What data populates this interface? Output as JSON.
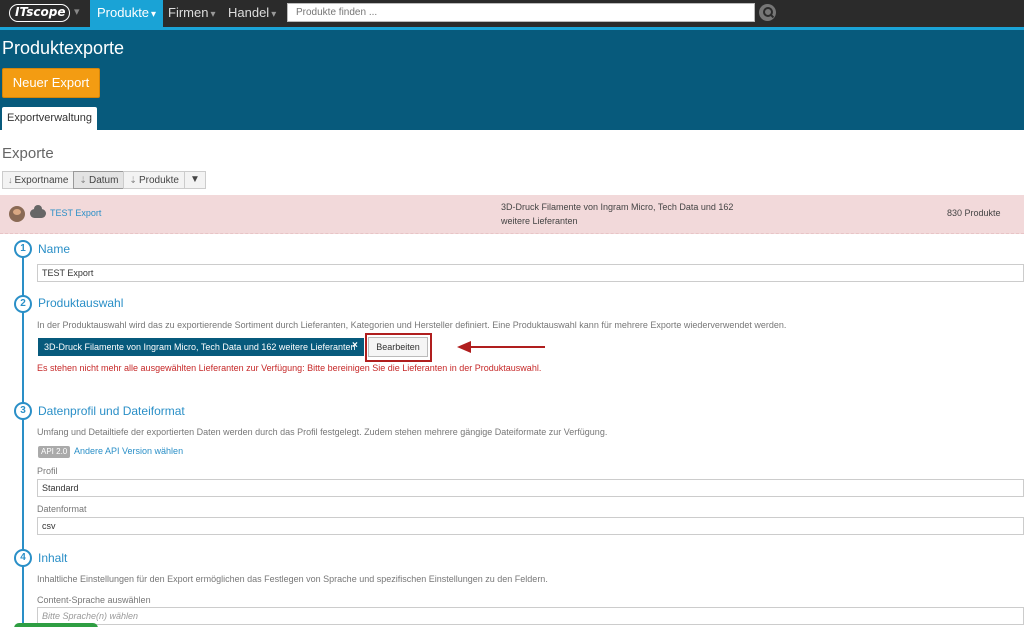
{
  "nav": {
    "logo": "ITscope",
    "items": [
      {
        "label": "Produkte",
        "active": true
      },
      {
        "label": "Firmen",
        "active": false
      },
      {
        "label": "Handel",
        "active": false
      }
    ],
    "search_placeholder": "Produkte finden ..."
  },
  "header": {
    "title": "Produktexporte",
    "new_button": "Neuer Export",
    "tab": "Exportverwaltung"
  },
  "exports": {
    "title": "Exporte",
    "sort_buttons": [
      {
        "label": "Exportname",
        "active": false
      },
      {
        "label": "Datum",
        "active": true
      },
      {
        "label": "Produkte",
        "active": false
      }
    ],
    "row": {
      "name": "TEST Export",
      "description_line1": "3D-Druck Filamente von Ingram Micro, Tech Data und 162",
      "description_line2": "weitere Lieferanten",
      "count": "830 Produkte"
    }
  },
  "steps": {
    "name": {
      "number": "1",
      "title": "Name",
      "value": "TEST Export"
    },
    "selection": {
      "number": "2",
      "title": "Produktauswahl",
      "help": "In der Produktauswahl wird das zu exportierende Sortiment durch Lieferanten, Kategorien und Hersteller definiert. Eine Produktauswahl kann für mehrere Exporte wiederverwendet werden.",
      "chip_label": "3D-Druck Filamente von Ingram Micro, Tech Data und 162 weitere Lieferanten",
      "chip_close": "×",
      "edit_button": "Bearbeiten",
      "error": "Es stehen nicht mehr alle ausgewählten Lieferanten zur Verfügung: Bitte bereinigen Sie die Lieferanten in der Produktauswahl."
    },
    "profile": {
      "number": "3",
      "title": "Datenprofil und Dateiformat",
      "help": "Umfang und Detailtiefe der exportierten Daten werden durch das Profil festgelegt. Zudem stehen mehrere gängige Dateiformate zur Verfügung.",
      "api_badge": "API 2.0",
      "api_link": "Andere API Version wählen",
      "profil_label": "Profil",
      "profil_value": "Standard",
      "format_label": "Datenformat",
      "format_value": "csv"
    },
    "content": {
      "number": "4",
      "title": "Inhalt",
      "help": "Inhaltliche Einstellungen für den Export ermöglichen das Festlegen von Sprache und spezifischen Einstellungen zu den Feldern.",
      "language_label": "Content-Sprache auswählen",
      "language_placeholder": "Bitte Sprache(n) wählen"
    }
  },
  "colors": {
    "accent": "#1aa3d6",
    "band": "#075a7c",
    "button_orange": "#f39c12",
    "error": "#c62828",
    "row_highlight": "#f2d9da"
  }
}
